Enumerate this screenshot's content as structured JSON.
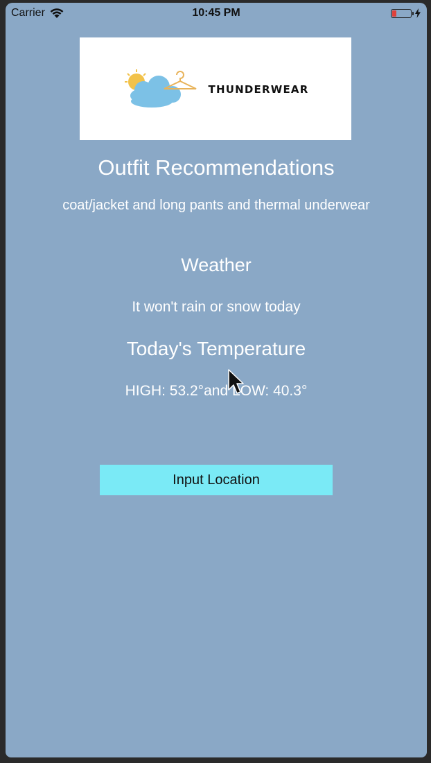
{
  "status_bar": {
    "carrier": "Carrier",
    "time": "10:45 PM",
    "battery_level": 0.2,
    "icons": [
      "wifi-icon",
      "battery-icon",
      "charging-bolt-icon"
    ]
  },
  "logo": {
    "brand_text": "THUNDERWEAR",
    "mark_icons": [
      "sun-icon",
      "cloud-icon",
      "hanger-icon"
    ]
  },
  "outfit": {
    "heading": "Outfit Recommendations",
    "recommendation": "coat/jacket and long pants and thermal underwear"
  },
  "weather": {
    "heading": "Weather",
    "description": "It won't rain or snow today"
  },
  "temperature": {
    "heading": "Today's Temperature",
    "summary": "HIGH: 53.2°and LOW: 40.3°"
  },
  "actions": {
    "input_location_label": "Input Location"
  },
  "colors": {
    "background": "#8aa8c6",
    "button": "#7aeaf6",
    "text": "#ffffff",
    "battery_low": "#e0413a"
  }
}
